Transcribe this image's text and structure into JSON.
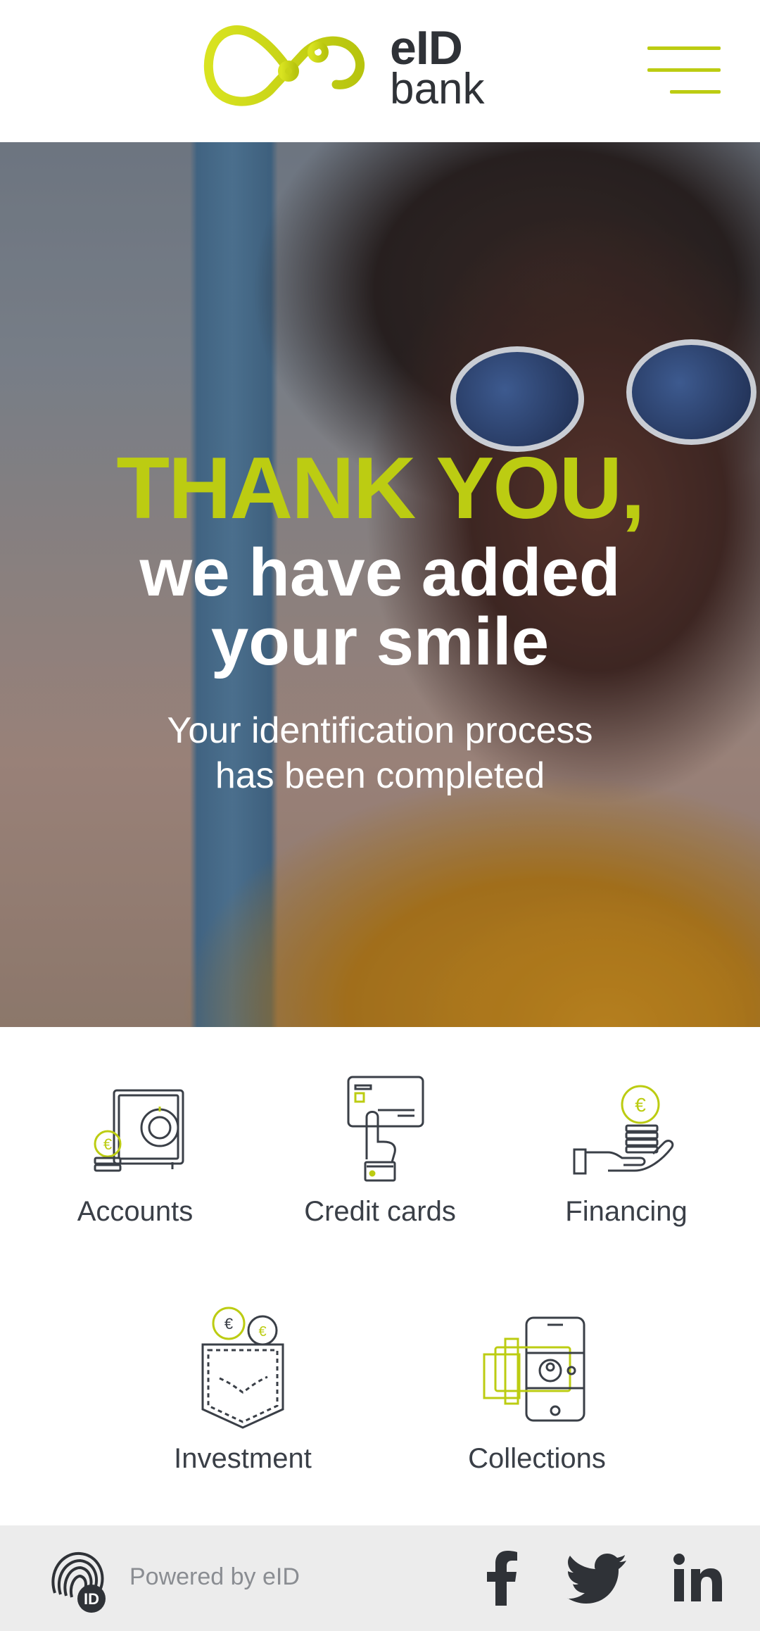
{
  "header": {
    "logo_line1": "eID",
    "logo_line2": "bank",
    "menu_icon": "hamburger-menu-icon"
  },
  "hero": {
    "headline": "THANK YOU,",
    "line2": "we have added",
    "line3": "your smile",
    "subtitle_line1": "Your identification process",
    "subtitle_line2": "has been completed"
  },
  "services": [
    {
      "label": "Accounts",
      "icon": "safe-icon"
    },
    {
      "label": "Credit cards",
      "icon": "credit-card-icon"
    },
    {
      "label": "Financing",
      "icon": "hand-coins-icon"
    },
    {
      "label": "Investment",
      "icon": "pocket-coins-icon"
    },
    {
      "label": "Collections",
      "icon": "phone-money-icon"
    }
  ],
  "footer": {
    "powered_by": "Powered by eID",
    "badge_text": "ID",
    "social": [
      "facebook-icon",
      "twitter-icon",
      "linkedin-icon"
    ]
  },
  "colors": {
    "accent": "#bccc12",
    "icon_stroke": "#3a3f47",
    "footer_bg": "#ececec"
  }
}
